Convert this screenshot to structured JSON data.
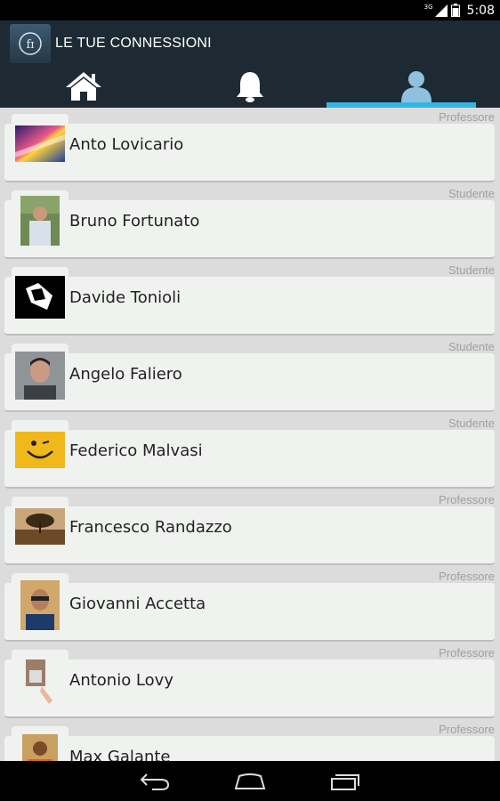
{
  "status": {
    "network": "3G",
    "time": "5:08"
  },
  "app": {
    "title": "LE TUE CONNESSIONI",
    "logo_text": "fɪ"
  },
  "tabs": [
    {
      "icon": "home-icon"
    },
    {
      "icon": "bell-icon"
    },
    {
      "icon": "person-icon",
      "selected": true
    }
  ],
  "connections": [
    {
      "name": "Anto Lovicario",
      "role": "Professore"
    },
    {
      "name": "Bruno Fortunato",
      "role": "Studente"
    },
    {
      "name": "Davide Tonioli",
      "role": "Studente"
    },
    {
      "name": "Angelo Faliero",
      "role": "Studente"
    },
    {
      "name": "Federico Malvasi",
      "role": "Studente"
    },
    {
      "name": "Francesco Randazzo",
      "role": "Professore"
    },
    {
      "name": "Giovanni Accetta",
      "role": "Professore"
    },
    {
      "name": "Antonio Lovy",
      "role": "Professore"
    },
    {
      "name": "Max Galante",
      "role": "Professore"
    }
  ],
  "colors": {
    "accent": "#33b5e5",
    "actionbar": "#1d2a33"
  }
}
